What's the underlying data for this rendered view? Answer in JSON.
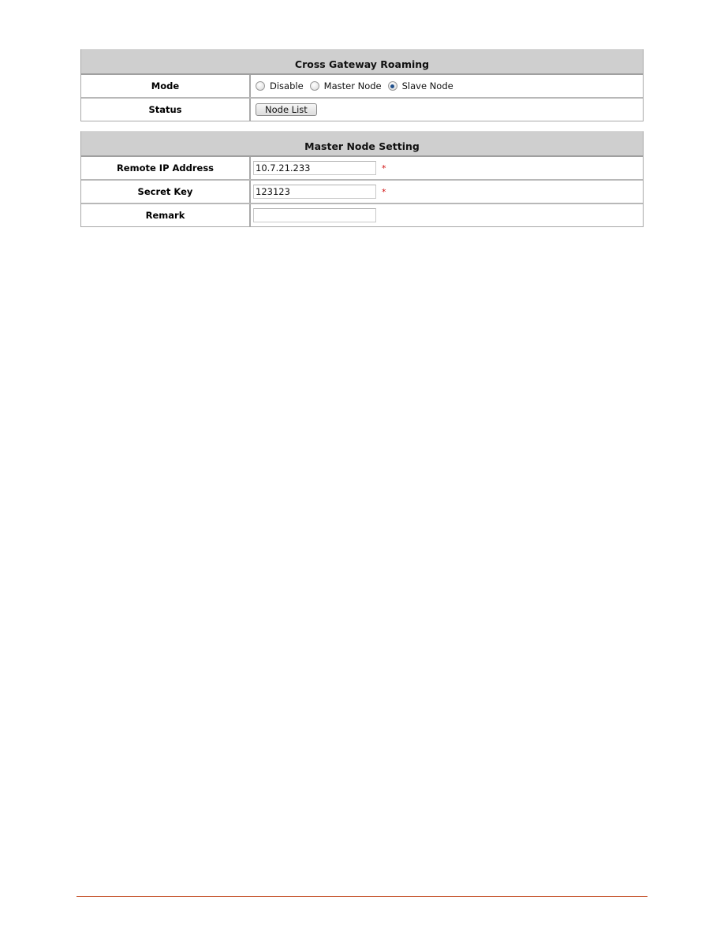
{
  "cross_gateway_roaming": {
    "title": "Cross Gateway Roaming",
    "mode": {
      "label": "Mode",
      "options": [
        {
          "label": "Disable",
          "checked": false
        },
        {
          "label": "Master Node",
          "checked": false
        },
        {
          "label": "Slave Node",
          "checked": true
        }
      ]
    },
    "status": {
      "label": "Status",
      "button_label": "Node List"
    }
  },
  "master_node_setting": {
    "title": "Master Node Setting",
    "fields": [
      {
        "label": "Remote IP Address",
        "value": "10.7.21.233",
        "required": true,
        "required_mark": "*"
      },
      {
        "label": "Secret Key",
        "value": "123123",
        "required": true,
        "required_mark": "*"
      },
      {
        "label": "Remark",
        "value": "",
        "required": false,
        "required_mark": ""
      }
    ]
  },
  "colors": {
    "header_bg": "#cfcfcf",
    "required_mark": "#d01010",
    "footer_rule": "#c0461c"
  }
}
